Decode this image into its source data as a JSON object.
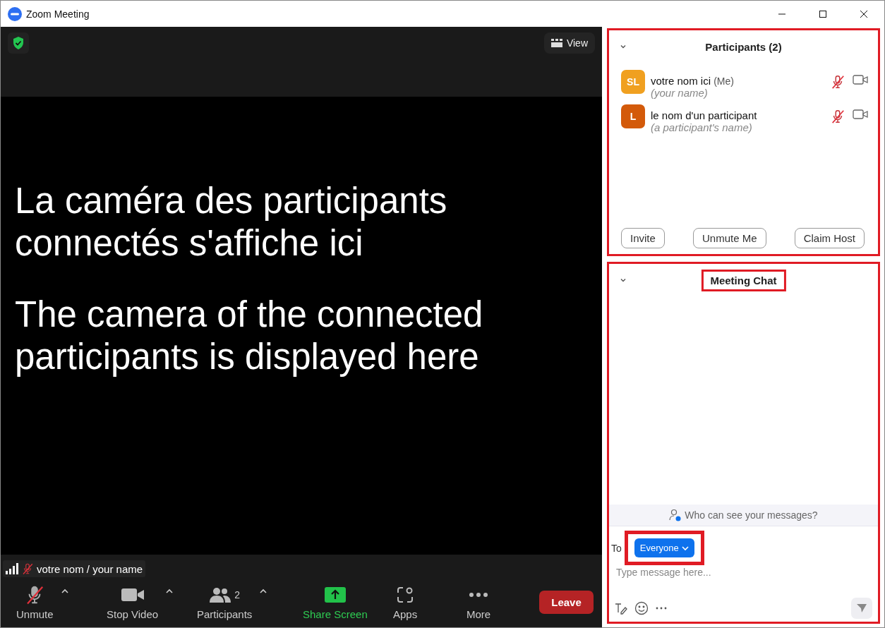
{
  "window": {
    "title": "Zoom Meeting"
  },
  "video": {
    "view_button": "View",
    "caption": [
      "La caméra des participants connectés s'affiche ici",
      "The camera of the connected participants is displayed here"
    ],
    "name_tag": {
      "name": "votre nom / your name",
      "muted": true
    }
  },
  "toolbar": [
    {
      "kind": "mic",
      "label": "Unmute",
      "muted": true,
      "caret": true
    },
    {
      "kind": "video",
      "label": "Stop Video",
      "muted": false,
      "caret": true
    },
    {
      "kind": "participants",
      "label": "Participants",
      "count": "2",
      "caret": true
    },
    {
      "kind": "share",
      "label": "Share Screen"
    },
    {
      "kind": "apps",
      "label": "Apps"
    },
    {
      "kind": "more",
      "label": "More"
    }
  ],
  "leave_button": "Leave",
  "participants_panel": {
    "title": "Participants (2)",
    "highlighted": true,
    "participants": [
      {
        "initials": "SL",
        "color": "#f0a020",
        "name": "votre nom ici",
        "me_tag": "(Me)",
        "subtitle": "(your name)",
        "muted": true
      },
      {
        "initials": "L",
        "color": "#d35a0a",
        "name": "le nom d'un participant",
        "subtitle": "(a participant's name)",
        "muted": true
      }
    ],
    "buttons": [
      "Invite",
      "Unmute Me",
      "Claim Host"
    ]
  },
  "chat_panel": {
    "title": "Meeting Chat",
    "highlighted": true,
    "title_highlighted": true,
    "privacy_note": "Who can see your messages?",
    "to_label": "To",
    "recipient": "Everyone",
    "recipient_highlighted": true,
    "placeholder": "Type message here..."
  }
}
